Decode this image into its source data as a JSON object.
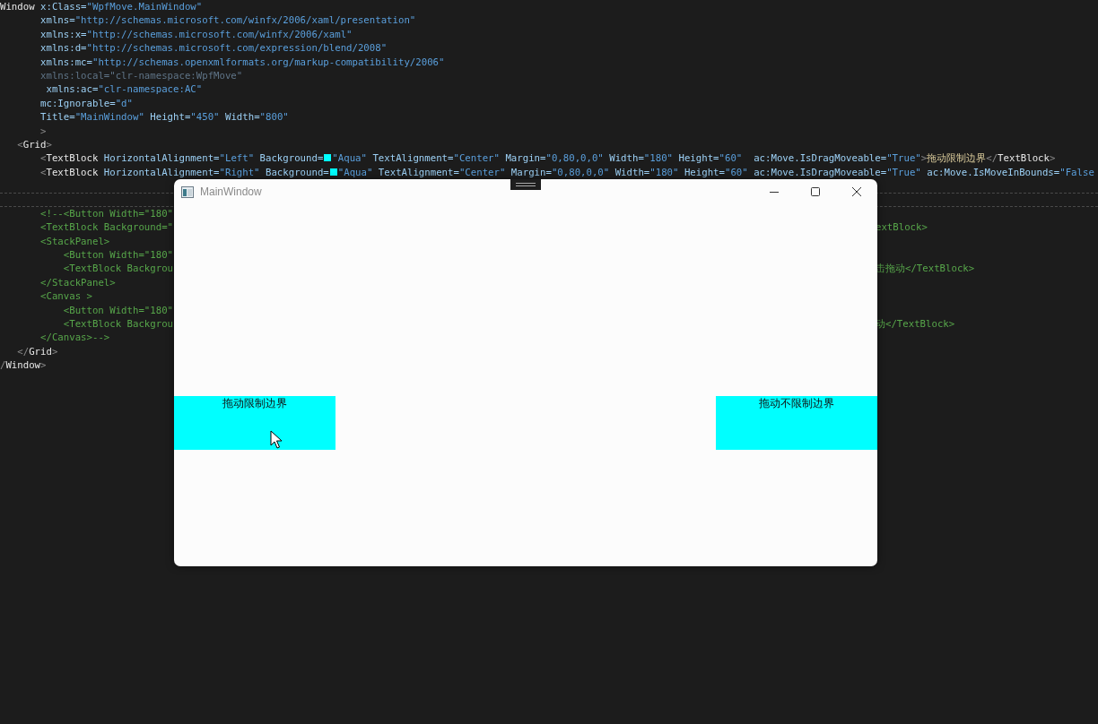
{
  "editor": {
    "lines": [
      {
        "current": false,
        "tokens": [
          {
            "kind": "tag",
            "text": "Window"
          },
          {
            "kind": "attr",
            "text": " x:Class="
          },
          {
            "kind": "value",
            "text": "\"WpfMove.MainWindow\""
          }
        ]
      },
      {
        "current": false,
        "tokens": [
          {
            "kind": "attr",
            "text": "       xmlns="
          },
          {
            "kind": "value",
            "text": "\"http://schemas.microsoft.com/winfx/2006/xaml/presentation\""
          }
        ]
      },
      {
        "current": false,
        "tokens": [
          {
            "kind": "attr",
            "text": "       xmlns:x="
          },
          {
            "kind": "value",
            "text": "\"http://schemas.microsoft.com/winfx/2006/xaml\""
          }
        ]
      },
      {
        "current": false,
        "tokens": [
          {
            "kind": "attr",
            "text": "       xmlns:d="
          },
          {
            "kind": "value",
            "text": "\"http://schemas.microsoft.com/expression/blend/2008\""
          }
        ]
      },
      {
        "current": false,
        "tokens": [
          {
            "kind": "attr",
            "text": "       xmlns:mc="
          },
          {
            "kind": "value",
            "text": "\"http://schemas.openxmlformats.org/markup-compatibility/2006\""
          }
        ]
      },
      {
        "current": false,
        "tokens": [
          {
            "kind": "dim",
            "text": "       xmlns:local=\"clr-namespace:WpfMove\""
          }
        ]
      },
      {
        "current": false,
        "tokens": [
          {
            "kind": "attr",
            "text": "        xmlns:ac="
          },
          {
            "kind": "value",
            "text": "\"clr-namespace:AC\""
          }
        ]
      },
      {
        "current": false,
        "tokens": [
          {
            "kind": "attr",
            "text": "       mc:Ignorable="
          },
          {
            "kind": "value",
            "text": "\"d\""
          }
        ]
      },
      {
        "current": false,
        "tokens": [
          {
            "kind": "attr",
            "text": "       Title="
          },
          {
            "kind": "value",
            "text": "\"MainWindow\""
          },
          {
            "kind": "attr",
            "text": " Height="
          },
          {
            "kind": "value",
            "text": "\"450\""
          },
          {
            "kind": "attr",
            "text": " Width="
          },
          {
            "kind": "value",
            "text": "\"800\""
          }
        ]
      },
      {
        "current": false,
        "tokens": [
          {
            "kind": "punct",
            "text": "       >"
          }
        ]
      },
      {
        "current": false,
        "tokens": [
          {
            "kind": "punct",
            "text": "   <"
          },
          {
            "kind": "tag",
            "text": "Grid"
          },
          {
            "kind": "punct",
            "text": ">"
          }
        ]
      },
      {
        "current": false,
        "tokens": [
          {
            "kind": "punct",
            "text": "       <"
          },
          {
            "kind": "tag",
            "text": "TextBlock"
          },
          {
            "kind": "attr",
            "text": " HorizontalAlignment="
          },
          {
            "kind": "value",
            "text": "\"Left\""
          },
          {
            "kind": "attr",
            "text": " Background="
          },
          {
            "kind": "swatch",
            "color": "#00ffff"
          },
          {
            "kind": "value",
            "text": "\"Aqua\""
          },
          {
            "kind": "attr",
            "text": " TextAlignment="
          },
          {
            "kind": "value",
            "text": "\"Center\""
          },
          {
            "kind": "attr",
            "text": " Margin="
          },
          {
            "kind": "value",
            "text": "\"0,80,0,0\""
          },
          {
            "kind": "attr",
            "text": " Width="
          },
          {
            "kind": "value",
            "text": "\"180\""
          },
          {
            "kind": "attr",
            "text": " Height="
          },
          {
            "kind": "value",
            "text": "\"60\""
          },
          {
            "kind": "attr",
            "text": "  ac:Move.IsDragMoveable="
          },
          {
            "kind": "value",
            "text": "\"True\""
          },
          {
            "kind": "punct",
            "text": ">"
          },
          {
            "kind": "text",
            "text": "拖动限制边界"
          },
          {
            "kind": "punct",
            "text": "</"
          },
          {
            "kind": "tag",
            "text": "TextBlock"
          },
          {
            "kind": "punct",
            "text": ">"
          }
        ]
      },
      {
        "current": false,
        "tokens": [
          {
            "kind": "punct",
            "text": "       <"
          },
          {
            "kind": "tag",
            "text": "TextBlock"
          },
          {
            "kind": "attr",
            "text": " HorizontalAlignment="
          },
          {
            "kind": "value",
            "text": "\"Right\""
          },
          {
            "kind": "attr",
            "text": " Background="
          },
          {
            "kind": "swatch",
            "color": "#00ffff"
          },
          {
            "kind": "value",
            "text": "\"Aqua\""
          },
          {
            "kind": "attr",
            "text": " TextAlignment="
          },
          {
            "kind": "value",
            "text": "\"Center\""
          },
          {
            "kind": "attr",
            "text": " Margin="
          },
          {
            "kind": "value",
            "text": "\"0,80,0,0\""
          },
          {
            "kind": "attr",
            "text": " Width="
          },
          {
            "kind": "value",
            "text": "\"180\""
          },
          {
            "kind": "attr",
            "text": " Height="
          },
          {
            "kind": "value",
            "text": "\"60\""
          },
          {
            "kind": "attr",
            "text": " ac:Move.IsDragMoveable="
          },
          {
            "kind": "value",
            "text": "\"True\""
          },
          {
            "kind": "attr",
            "text": " ac:Move.IsMoveInBounds="
          },
          {
            "kind": "value",
            "text": "\"False"
          }
        ]
      },
      {
        "current": false
      },
      {
        "current": true
      },
      {
        "current": false,
        "tokens": [
          {
            "kind": "comment",
            "text": "       <!--<Button Width=\"180\""
          }
        ]
      },
      {
        "current": false,
        "tokens": [
          {
            "kind": "comment",
            "text": "       <TextBlock Background=\""
          }
        ],
        "right": [
          {
            "kind": "comment",
            "text": "extBlock>"
          }
        ]
      },
      {
        "current": false,
        "tokens": [
          {
            "kind": "comment",
            "text": "       <StackPanel>"
          }
        ]
      },
      {
        "current": false,
        "tokens": [
          {
            "kind": "comment",
            "text": "           <Button Width=\"180\""
          }
        ]
      },
      {
        "current": false,
        "tokens": [
          {
            "kind": "comment",
            "text": "           <TextBlock Backgrou"
          }
        ],
        "right": [
          {
            "kind": "comment",
            "text": "击拖动</TextBlock>"
          }
        ]
      },
      {
        "current": false,
        "tokens": [
          {
            "kind": "comment",
            "text": "       </StackPanel>"
          }
        ]
      },
      {
        "current": false,
        "tokens": [
          {
            "kind": "comment",
            "text": "       <Canvas >"
          }
        ]
      },
      {
        "current": false,
        "tokens": [
          {
            "kind": "comment",
            "text": "           <Button Width=\"180\""
          }
        ]
      },
      {
        "current": false,
        "tokens": [
          {
            "kind": "comment",
            "text": "           <TextBlock Backgrou"
          }
        ],
        "right": [
          {
            "kind": "comment",
            "text": "动</TextBlock>"
          }
        ]
      },
      {
        "current": false,
        "tokens": [
          {
            "kind": "comment",
            "text": "       </Canvas>-->"
          }
        ]
      },
      {
        "current": false,
        "tokens": [
          {
            "kind": "punct",
            "text": "   </"
          },
          {
            "kind": "tag",
            "text": "Grid"
          },
          {
            "kind": "punct",
            "text": ">"
          }
        ]
      },
      {
        "current": false,
        "tokens": [
          {
            "kind": "punct",
            "text": "/"
          },
          {
            "kind": "tag",
            "text": "Window"
          },
          {
            "kind": "punct",
            "text": ">"
          }
        ]
      }
    ]
  },
  "window": {
    "title": "MainWindow",
    "blocks": [
      {
        "text": "拖动限制边界",
        "kind": "left"
      },
      {
        "text": "拖动不限制边界",
        "kind": "right"
      }
    ]
  }
}
